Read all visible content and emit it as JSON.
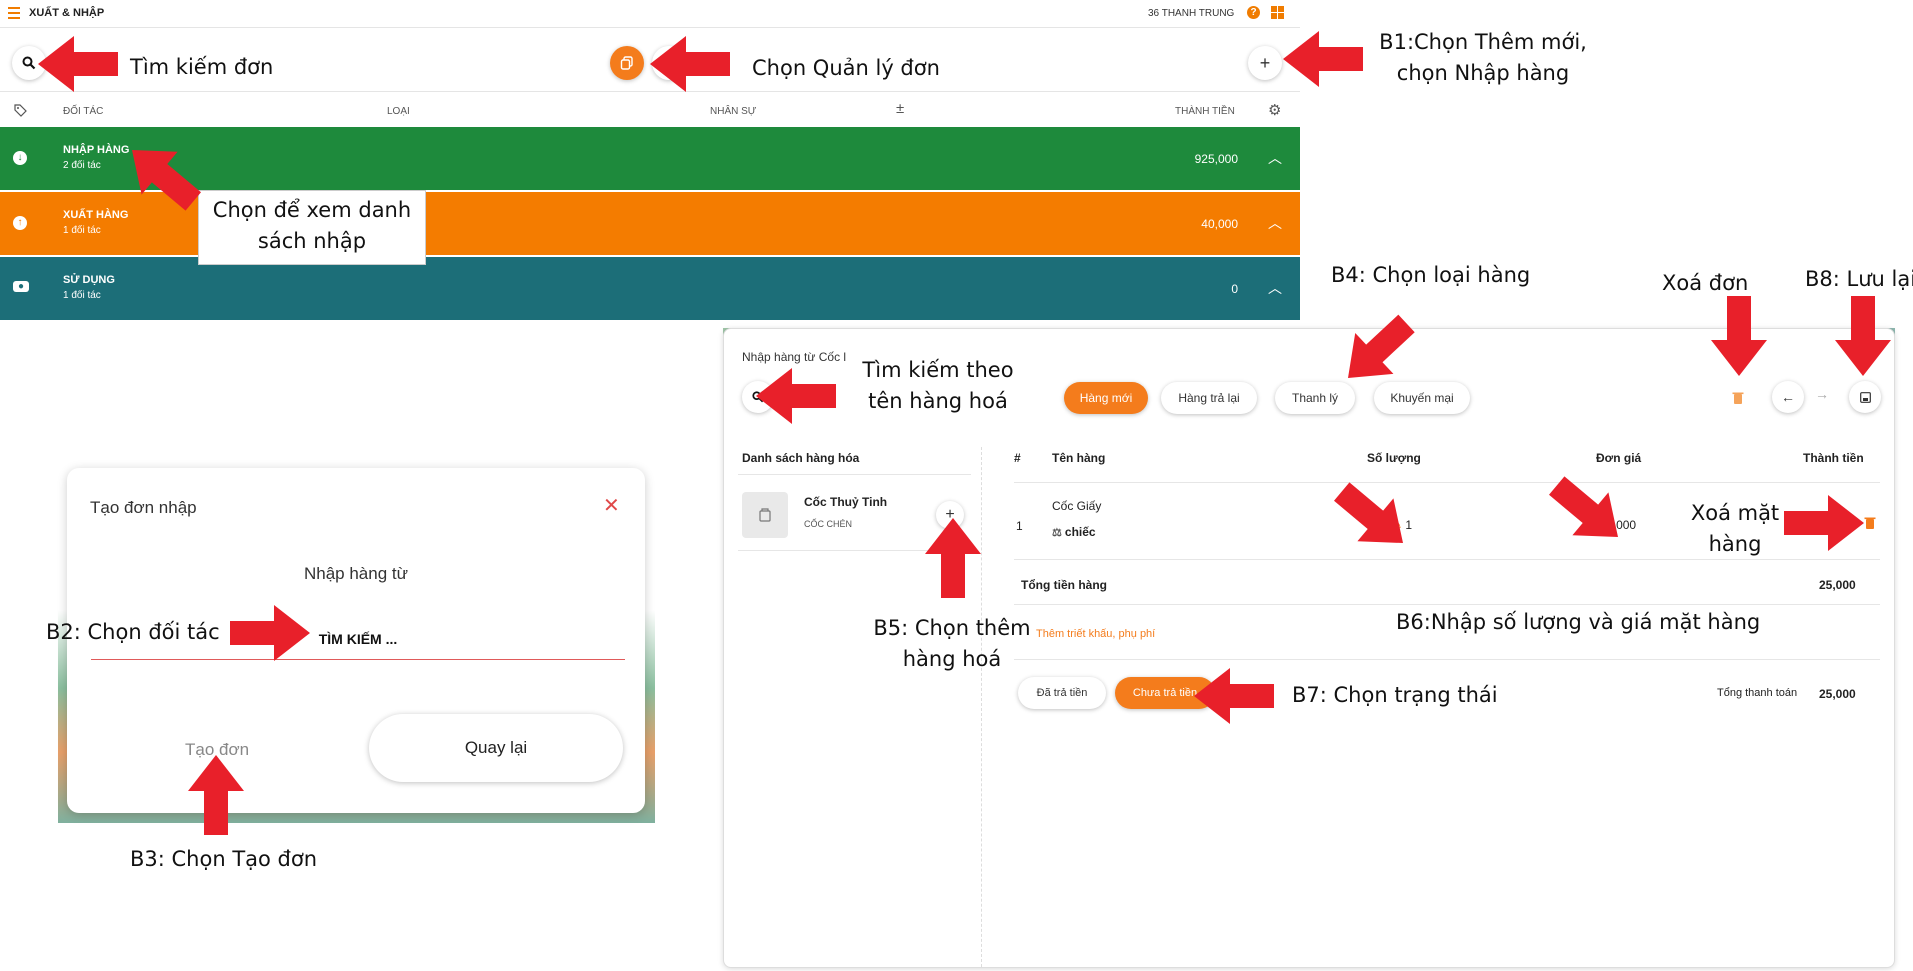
{
  "app": {
    "title": "XUẤT & NHẬP",
    "user": "36 THANH TRUNG",
    "help": "?"
  },
  "table_header": {
    "col_partner": "ĐỐI TÁC",
    "col_type": "LOẠI",
    "col_staff": "NHÂN SỰ",
    "col_total": "THÀNH TIỀN"
  },
  "groups": [
    {
      "title": "NHẬP HÀNG",
      "sub": "2 đối tác",
      "value": "925,000",
      "color": "#1e8a3c"
    },
    {
      "title": "XUẤT HÀNG",
      "sub": "1 đối tác",
      "value": "40,000",
      "color": "#f47c00"
    },
    {
      "title": "SỬ DỤNG",
      "sub": "1 đối tác",
      "value": "0",
      "color": "#1c6e78"
    }
  ],
  "dialog": {
    "title": "Tạo đơn nhập",
    "label": "Nhập hàng từ",
    "search": "TÌM KIẾM ...",
    "create": "Tạo đơn",
    "back": "Quay lại"
  },
  "panel": {
    "title": "Nhập hàng từ Cốc l",
    "chips": [
      "Hàng mới",
      "Hàng trả lại",
      "Thanh lý",
      "Khuyến mại"
    ],
    "list_title": "Danh sách hàng hóa",
    "product": {
      "name": "Cốc Thuỷ Tinh",
      "category": "CỐC CHÉN"
    },
    "cols": {
      "num": "#",
      "name": "Tên hàng",
      "qty": "Số lượng",
      "price": "Đơn giá",
      "total": "Thành tiền"
    },
    "row": {
      "num": "1",
      "name": "Cốc Giấy",
      "unit": "chiếc",
      "qty": "1",
      "price": "25,000"
    },
    "subtotal_label": "Tổng tiền hàng",
    "subtotal": "25,000",
    "discount_link": "Thêm triết khấu, phụ phí",
    "paid": "Đã trả tiền",
    "unpaid": "Chưa trả tiền",
    "grand_label": "Tổng thanh toán",
    "grand": "25,000"
  },
  "annotations": {
    "search_order": "Tìm kiếm đơn",
    "manage": "Chọn Quản lý đơn",
    "b1_l1": "B1:Chọn Thêm mới,",
    "b1_l2": "chọn Nhập hàng",
    "view_l1": "Chọn để xem danh",
    "view_l2": "sách nhập",
    "b4": "B4: Chọn loại hàng",
    "delete_order": "Xoá đơn",
    "b8": "B8: Lưu lại",
    "search_goods_l1": "Tìm kiếm theo",
    "search_goods_l2": "tên hàng hoá",
    "del_item_l1": "Xoá mặt",
    "del_item_l2": "hàng",
    "b2": "B2: Chọn đối tác",
    "b5_l1": "B5: Chọn thêm",
    "b5_l2": "hàng hoá",
    "b6": "B6:Nhập số lượng và giá mặt hàng",
    "b7": "B7: Chọn trạng thái",
    "b3": "B3: Chọn Tạo đơn"
  },
  "colors": {
    "accent": "#f47c1c",
    "arrow": "#e8202a"
  }
}
